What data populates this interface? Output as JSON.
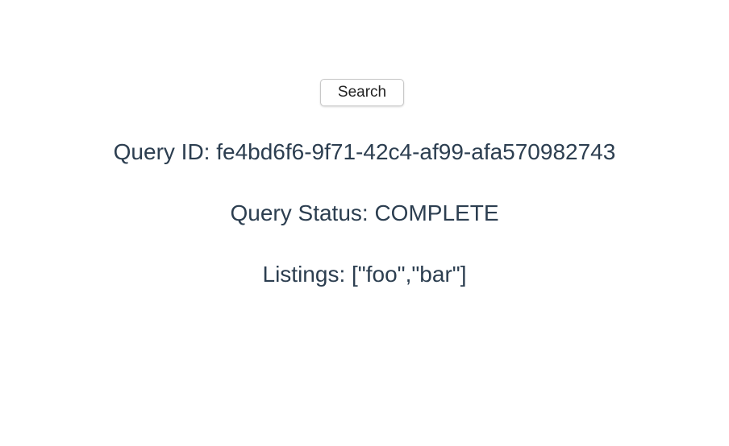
{
  "search_button": {
    "label": "Search"
  },
  "query": {
    "id_text": "Query ID: fe4bd6f6-9f71-42c4-af99-afa570982743",
    "status_text": "Query Status: COMPLETE",
    "listings_text": "Listings: [\"foo\",\"bar\"]"
  },
  "colors": {
    "text": "#2c3e50"
  }
}
